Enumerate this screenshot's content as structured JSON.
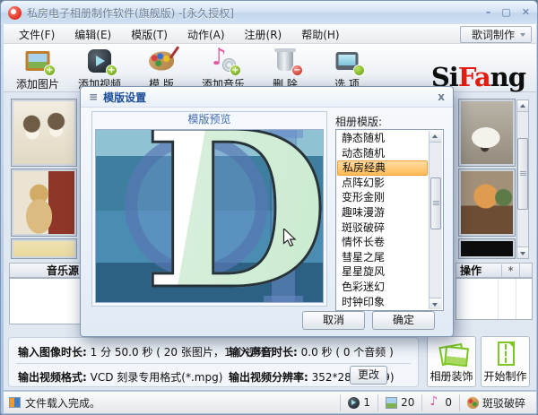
{
  "window": {
    "title": "私房电子相册制作软件(旗舰版) -[永久授权]",
    "minimize_label": "–",
    "maximize_label": "▢",
    "close_label": "✕"
  },
  "menu": {
    "items": [
      "文件(F)",
      "编辑(E)",
      "模版(T)",
      "动作(A)",
      "注册(R)",
      "帮助(H)"
    ],
    "lyrics_button": "歌词制作"
  },
  "toolbar": {
    "buttons": [
      {
        "label": "添加图片",
        "icon": "add-image-icon",
        "art": "ti-add-image",
        "badge": "+",
        "badge_color": "green"
      },
      {
        "label": "添加视频",
        "icon": "add-video-icon",
        "art": "ti-add-video",
        "badge": "+",
        "badge_color": "green"
      },
      {
        "label": "模 版",
        "icon": "palette-icon",
        "art": "ti-palette",
        "badge": "",
        "badge_color": "none"
      },
      {
        "label": "添加音乐",
        "icon": "add-music-icon",
        "art": "ti-add-music",
        "badge": "+",
        "badge_color": "green"
      },
      {
        "label": "删 除",
        "icon": "trash-icon",
        "art": "ti-trash",
        "badge": "−",
        "badge_color": "red"
      },
      {
        "label": "选 项",
        "icon": "options-icon",
        "art": "ti-options",
        "badge": "✱",
        "badge_color": "green"
      }
    ],
    "logo": {
      "black1": "Si",
      "red": "Fa",
      "black2": "ng"
    }
  },
  "left_panel": {
    "music_header": "音乐源",
    "thumbnails": [
      {
        "name": "two-puppies-photo",
        "art": "lthumb0",
        "cropped": false
      },
      {
        "name": "labrador-photo",
        "art": "lthumb1",
        "cropped": false
      },
      {
        "name": "cropped-photo",
        "art": "lthumb2",
        "cropped": true
      }
    ]
  },
  "right_panel": {
    "ops_header": "操作",
    "ops_col2": "*",
    "thumbnails": [
      {
        "name": "white-dog-photo",
        "art": "rthumb0",
        "cropped": false
      },
      {
        "name": "chow-puppy-photo",
        "art": "rthumb1",
        "cropped": false
      },
      {
        "name": "dark-photo",
        "art": "rthumb2",
        "cropped": true
      }
    ]
  },
  "dialog": {
    "title": "模版设置",
    "sys_icon": "≡",
    "close_label": "x",
    "preview_header": "模版预览",
    "list_label": "相册模版:",
    "templates": [
      "静态随机",
      "动态随机",
      "私房经典",
      "点阵幻影",
      "变形金刚",
      "趣味漫游",
      "斑驳破碎",
      "情怀长卷",
      "彗星之尾",
      "星星旋风",
      "色彩迷幻",
      "时钟印象"
    ],
    "selected_template": "私房经典",
    "selected_index": 2,
    "selection_color": "#ffba54",
    "cancel_label": "取消",
    "ok_label": "确定",
    "preview_letter": "D",
    "preview_stripe_colors": [
      "#8fc2d3",
      "#3e7e9e",
      "#4a8cb2",
      "#2c6184"
    ]
  },
  "bottom": {
    "image_duration_label": "输入图像时长:",
    "image_duration_value": "1 分 50.0 秒 ( 20 张图片，1 个视频 )",
    "audio_duration_label": "输入声音时长:",
    "audio_duration_value": "0.0 秒 ( 0 个音频 )",
    "format_label": "输出视频格式:",
    "format_value": "VCD 刻录专用格式(*.mpg)",
    "resolution_label": "输出视频分辨率:",
    "resolution_value": "352*288 (11:9)",
    "change_button": "更改",
    "decorate_button": "相册装饰",
    "start_button": "开始制作",
    "action_icon_color": "#7cc820"
  },
  "statusbar": {
    "message": "文件载入完成。",
    "video_count": "1",
    "image_count": "20",
    "audio_count": "0",
    "template_name": "斑驳破碎"
  }
}
